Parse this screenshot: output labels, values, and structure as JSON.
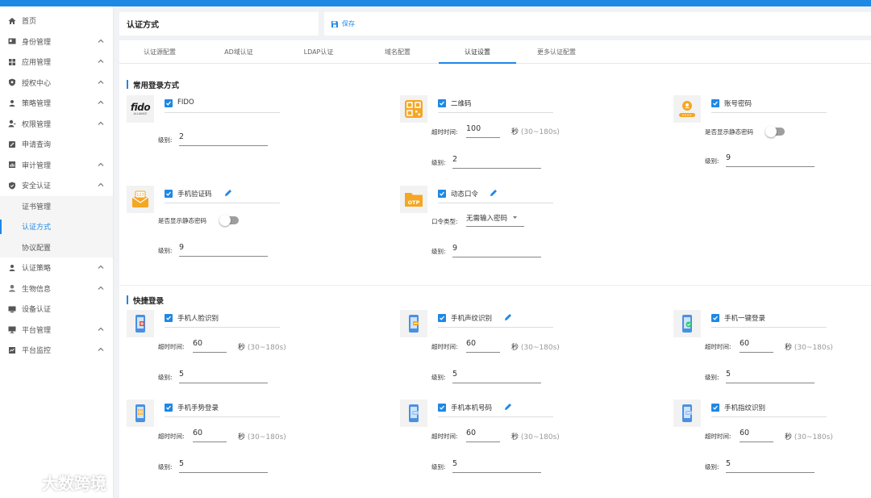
{
  "header": {
    "title": "认证方式",
    "save_label": "保存"
  },
  "sidebar": {
    "items": [
      {
        "label": "首页",
        "icon": "home-icon"
      },
      {
        "label": "身份管理",
        "icon": "id-card-icon"
      },
      {
        "label": "应用管理",
        "icon": "apps-icon"
      },
      {
        "label": "授权中心",
        "icon": "shield-key-icon"
      },
      {
        "label": "策略管理",
        "icon": "policy-icon"
      },
      {
        "label": "权限管理",
        "icon": "user-key-icon"
      },
      {
        "label": "申请查询",
        "icon": "form-icon"
      },
      {
        "label": "审计管理",
        "icon": "audit-icon"
      },
      {
        "label": "安全认证",
        "icon": "security-icon"
      },
      {
        "label": "证书管理"
      },
      {
        "label": "认证方式"
      },
      {
        "label": "协议配置"
      },
      {
        "label": "认证策略",
        "icon": "strategy-icon"
      },
      {
        "label": "生物信息",
        "icon": "bio-icon"
      },
      {
        "label": "设备认证",
        "icon": "device-icon"
      },
      {
        "label": "平台管理",
        "icon": "platform-icon"
      },
      {
        "label": "平台监控",
        "icon": "monitor-icon"
      }
    ]
  },
  "tabs": [
    "认证源配置",
    "AD域认证",
    "LDAP认证",
    "域名配置",
    "认证设置",
    "更多认证配置"
  ],
  "active_tab": "认证设置",
  "sections": {
    "common": "常用登录方式",
    "quick": "快捷登录"
  },
  "labels": {
    "timeout": "超时时间:",
    "level": "级别:",
    "seconds": "秒",
    "range": "(30~180s)",
    "show_static_pwd": "是否显示静态密码",
    "token_type": "口令类型:"
  },
  "common": {
    "fido": {
      "name": "FIDO",
      "level": "2",
      "logo_text": "fido",
      "logo_sub": "ALLIANCE"
    },
    "qrcode": {
      "name": "二维码",
      "timeout": "100",
      "level": "2"
    },
    "account": {
      "name": "账号密码",
      "level": "9"
    },
    "sms": {
      "name": "手机验证码",
      "level": "9"
    },
    "otp": {
      "name": "动态口令",
      "token_type": "无需输入密码",
      "level": "9",
      "logo_text": "OTP"
    }
  },
  "quick": {
    "face": {
      "name": "手机人脸识别",
      "timeout": "60",
      "level": "5"
    },
    "voice": {
      "name": "手机声纹识别",
      "timeout": "60",
      "level": "5"
    },
    "onekey": {
      "name": "手机一键登录",
      "timeout": "60",
      "level": "5"
    },
    "gesture": {
      "name": "手机手势登录",
      "timeout": "60",
      "level": "5"
    },
    "local": {
      "name": "手机本机号码",
      "timeout": "60",
      "level": "5"
    },
    "finger": {
      "name": "手机指纹识别",
      "timeout": "60",
      "level": "5"
    }
  },
  "watermark": "大数跨境",
  "colors": {
    "accent": "#1e88e5",
    "orange": "#f5a623",
    "phone_blue": "#4a90e2"
  }
}
